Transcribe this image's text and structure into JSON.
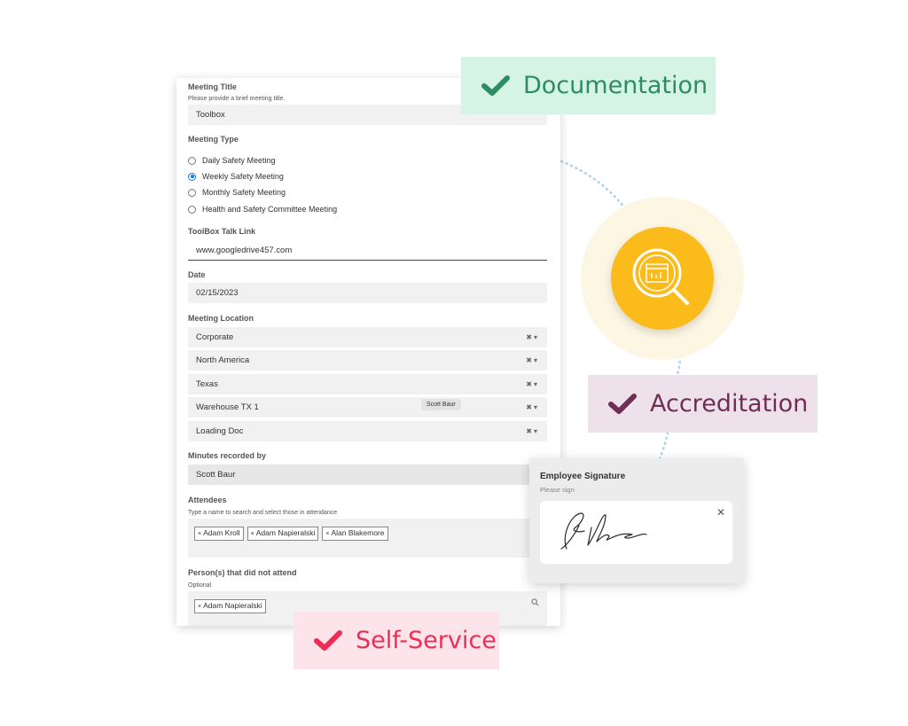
{
  "form": {
    "meeting_title": {
      "label": "Meeting Title",
      "help": "Please provide a brief meeting title.",
      "value": "Toolbox"
    },
    "meeting_type": {
      "label": "Meeting Type",
      "options": [
        {
          "label": "Daily Safety Meeting",
          "selected": false
        },
        {
          "label": "Weekly Safety Meeting",
          "selected": true
        },
        {
          "label": "Monthly Safety Meeting",
          "selected": false
        },
        {
          "label": "Health and Safety Committee Meeting",
          "selected": false
        }
      ]
    },
    "toolbox_link": {
      "label": "ToolBox Talk Link",
      "value": "www.googledrive457.com"
    },
    "date": {
      "label": "Date",
      "value": "02/15/2023"
    },
    "meeting_location": {
      "label": "Meeting Location",
      "values": [
        "Corporate",
        "North America",
        "Texas",
        "Warehouse TX 1",
        "Loading Doc"
      ],
      "tooltip": "Scott Baur"
    },
    "minutes_recorded_by": {
      "label": "Minutes recorded by",
      "value": "Scott Baur"
    },
    "attendees": {
      "label": "Attendees",
      "help": "Type a name to search and select those in attendance",
      "tags": [
        "Adam Kroll",
        "Adam Napieralski",
        "Alan Blakemore"
      ]
    },
    "did_not_attend": {
      "label": "Person(s) that did not attend",
      "help": "Optional",
      "tags": [
        "Adam Napieralski"
      ]
    }
  },
  "badges": {
    "documentation": "Documentation",
    "accreditation": "Accreditation",
    "self_service": "Self-Service"
  },
  "signature": {
    "title": "Employee Signature",
    "subtitle": "Please sign"
  },
  "colors": {
    "documentation_bg": "#d5f4e6",
    "documentation_fg": "#2c8c62",
    "accreditation_bg": "#efe1ea",
    "accreditation_fg": "#6e2e56",
    "self_service_bg": "#fde3ea",
    "self_service_fg": "#ec2e55",
    "badge_yellow": "#fbbb1a",
    "radio_selected": "#1a73e8"
  },
  "icons": {
    "badge": "magnifier-report-icon",
    "pill_check": "check-icon",
    "signature_close": "close-icon",
    "search": "search-icon"
  }
}
